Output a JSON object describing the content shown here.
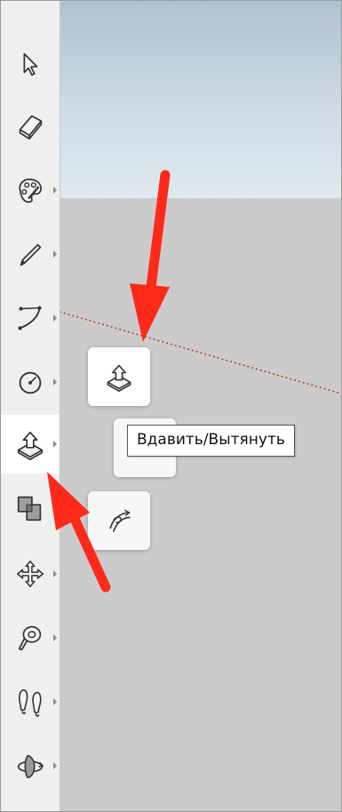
{
  "toolbar": {
    "tools": [
      {
        "name": "select",
        "icon": "arrow-cursor-icon",
        "has_flyout": false
      },
      {
        "name": "eraser",
        "icon": "eraser-icon",
        "has_flyout": false
      },
      {
        "name": "paint-bucket",
        "icon": "paint-bucket-icon",
        "has_flyout": true
      },
      {
        "name": "line",
        "icon": "pencil-icon",
        "has_flyout": true
      },
      {
        "name": "arc",
        "icon": "arc-icon",
        "has_flyout": true
      },
      {
        "name": "circle",
        "icon": "circle-icon",
        "has_flyout": true
      },
      {
        "name": "push-pull",
        "icon": "push-pull-icon",
        "has_flyout": true,
        "active": true
      },
      {
        "name": "solid-tools",
        "icon": "solid-tools-icon",
        "has_flyout": false
      },
      {
        "name": "move",
        "icon": "move-icon",
        "has_flyout": true
      },
      {
        "name": "tape-measure",
        "icon": "tape-measure-icon",
        "has_flyout": true
      },
      {
        "name": "walk",
        "icon": "footprints-icon",
        "has_flyout": true
      },
      {
        "name": "orbit",
        "icon": "orbit-icon",
        "has_flyout": true
      }
    ]
  },
  "flyout": {
    "items": [
      "push-pull-icon",
      "offset-icon",
      "follow-me-icon"
    ]
  },
  "tooltip": {
    "text": "Вдавить/Вытянуть"
  },
  "colors": {
    "annotation_arrow": "#ff2a1a",
    "axis_red": "#c0392b",
    "sky": "#c7d6e0",
    "ground": "#cbcbcb",
    "toolbar_bg": "#efeff0"
  }
}
